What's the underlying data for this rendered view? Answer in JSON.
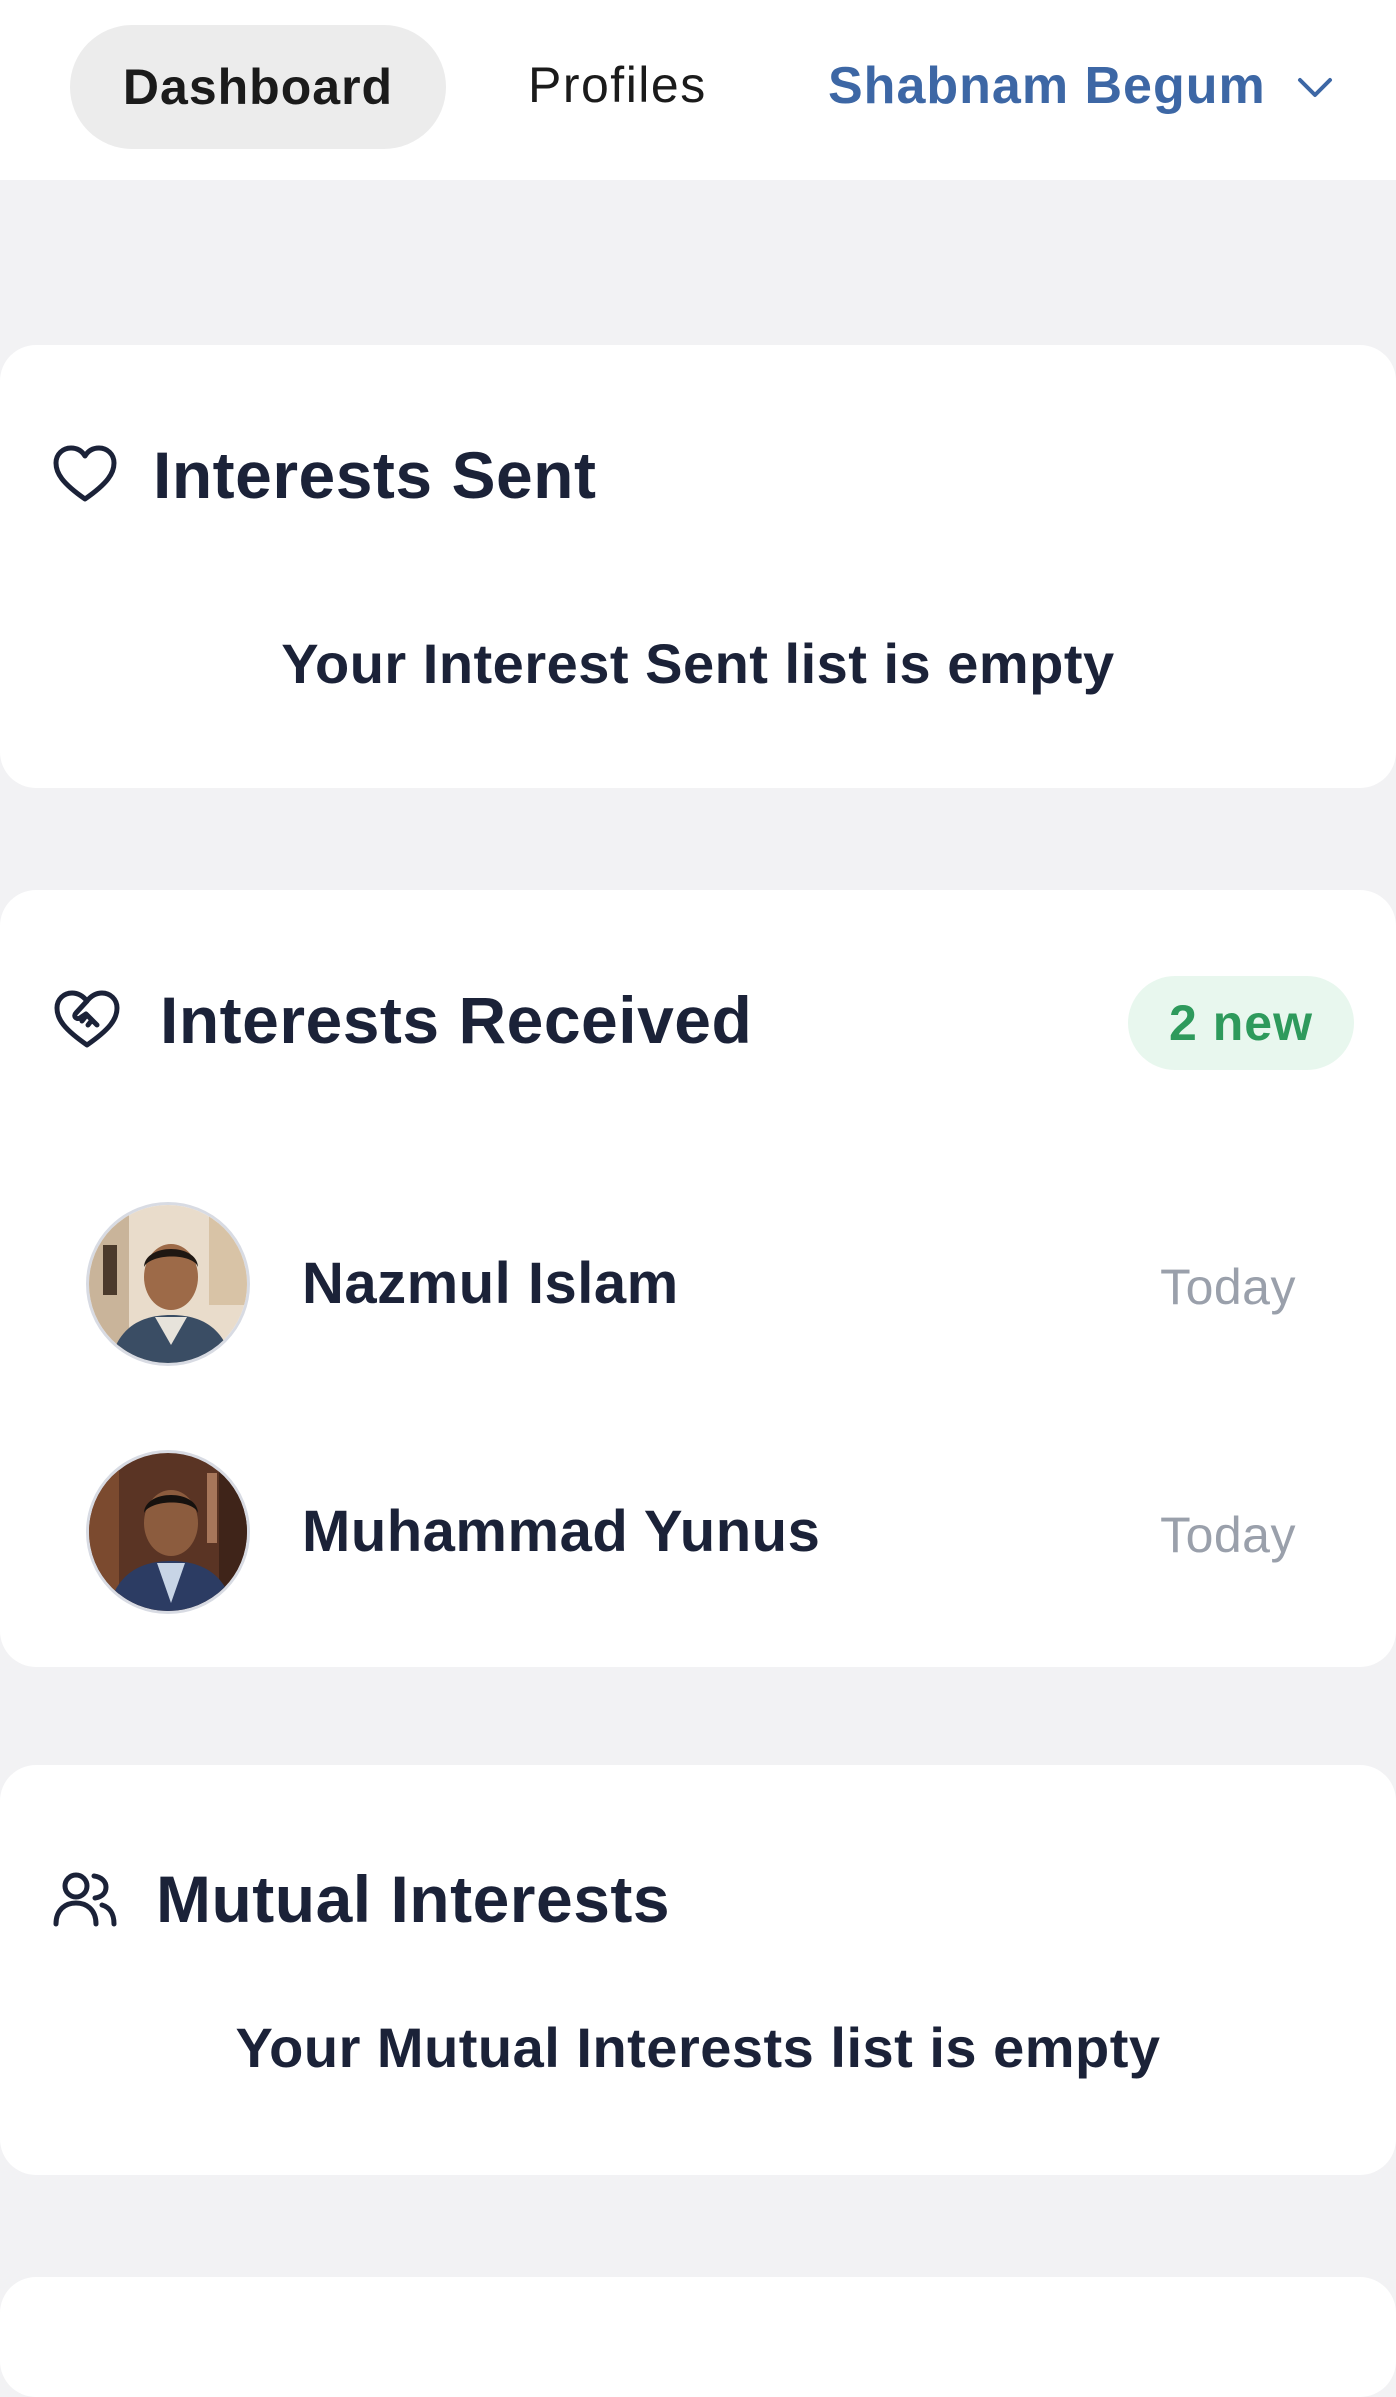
{
  "nav": {
    "dashboard_label": "Dashboard",
    "profiles_label": "Profiles",
    "user_name": "Shabnam Begum",
    "user_icon": "chevron-down-icon"
  },
  "interests_sent": {
    "title": "Interests Sent",
    "icon": "heart-icon",
    "empty_message": "Your Interest Sent list is empty"
  },
  "interests_received": {
    "title": "Interests Received",
    "icon": "heart-handshake-icon",
    "badge": "2 new",
    "items": [
      {
        "name": "Nazmul Islam",
        "time": "Today",
        "avatar": "avatar-photo"
      },
      {
        "name": "Muhammad Yunus",
        "time": "Today",
        "avatar": "avatar-photo"
      }
    ]
  },
  "mutual_interests": {
    "title": "Mutual Interests",
    "icon": "users-icon",
    "empty_message": "Your Mutual Interests list is empty"
  },
  "colors": {
    "accent_blue": "#3d67a5",
    "badge_green": "#2e9a5c",
    "badge_bg": "#e8f7ee",
    "page_bg": "#f2f2f4",
    "text_dark": "#1b2238",
    "text_muted": "#9aa0ab"
  }
}
